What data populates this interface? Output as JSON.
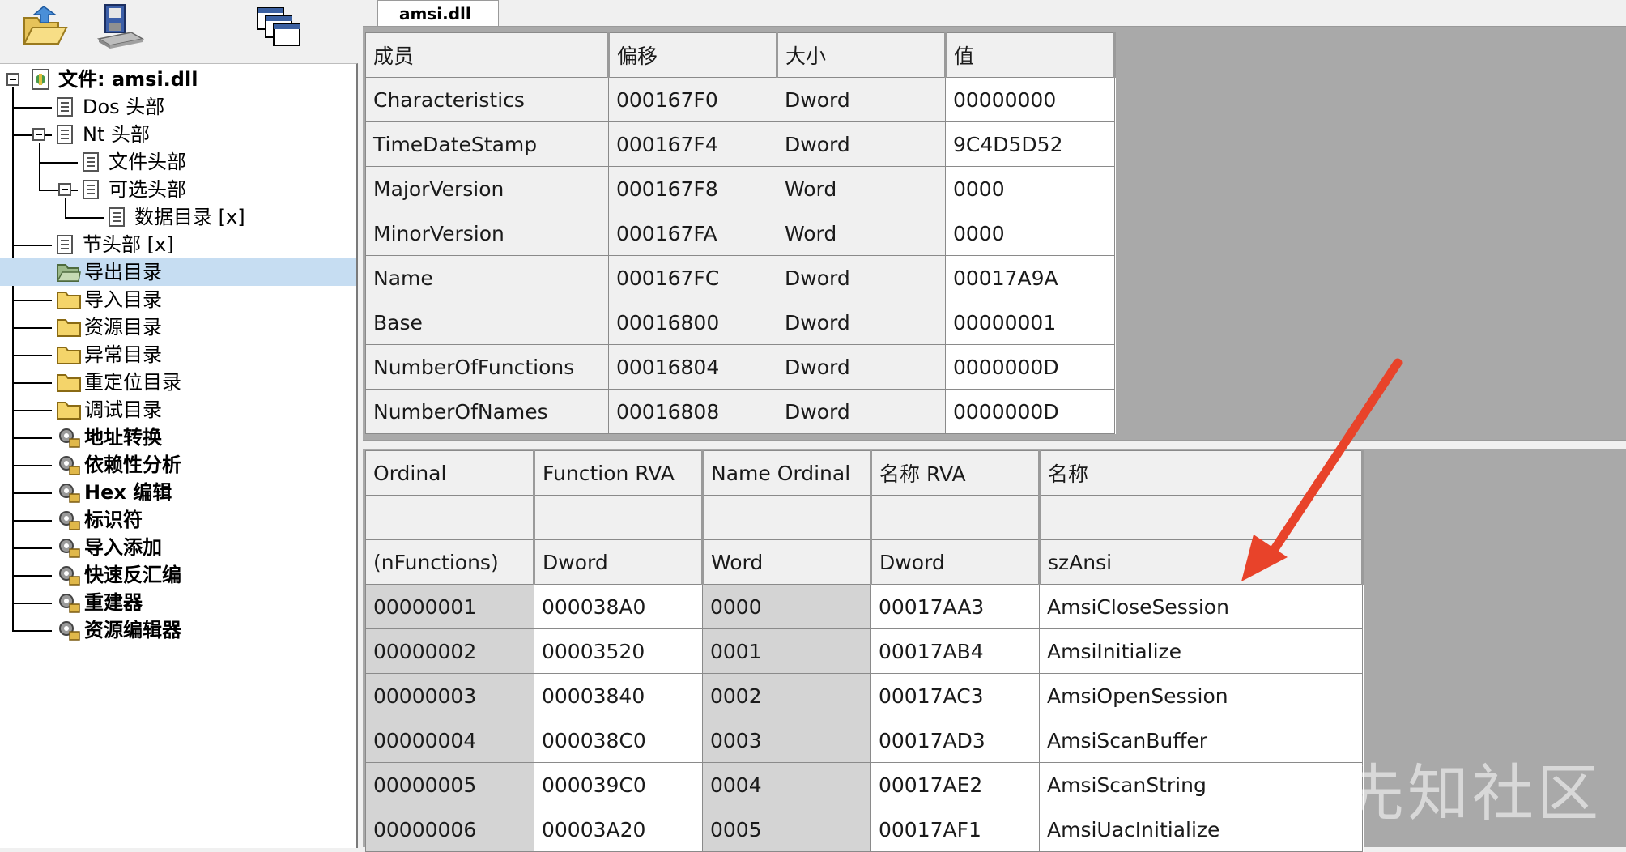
{
  "toolbar": {
    "buttons": [
      {
        "icon": "open-folder-icon"
      },
      {
        "icon": "save-disk-icon"
      },
      {
        "icon": "windows-icon"
      }
    ]
  },
  "tab": {
    "label": "amsi.dll"
  },
  "tree": {
    "root": "文件: amsi.dll",
    "items": [
      {
        "label": "Dos 头部",
        "icon": "page-icon"
      },
      {
        "label": "Nt 头部",
        "icon": "page-icon"
      },
      {
        "label": "文件头部",
        "icon": "page-icon"
      },
      {
        "label": "可选头部",
        "icon": "page-icon"
      },
      {
        "label": "数据目录 [x]",
        "icon": "page-icon"
      },
      {
        "label": "节头部 [x]",
        "icon": "page-icon"
      },
      {
        "label": "导出目录",
        "icon": "folder-open-icon"
      },
      {
        "label": "导入目录",
        "icon": "folder-icon"
      },
      {
        "label": "资源目录",
        "icon": "folder-icon"
      },
      {
        "label": "异常目录",
        "icon": "folder-icon"
      },
      {
        "label": "重定位目录",
        "icon": "folder-icon"
      },
      {
        "label": "调试目录",
        "icon": "folder-icon"
      },
      {
        "label": "地址转换",
        "icon": "tool-icon"
      },
      {
        "label": "依赖性分析",
        "icon": "tool-icon"
      },
      {
        "label": "Hex 编辑",
        "icon": "tool-icon"
      },
      {
        "label": "标识符",
        "icon": "tool-icon"
      },
      {
        "label": "导入添加",
        "icon": "tool-icon"
      },
      {
        "label": "快速反汇编",
        "icon": "tool-icon"
      },
      {
        "label": "重建器",
        "icon": "tool-icon"
      },
      {
        "label": "资源编辑器",
        "icon": "tool-icon"
      }
    ],
    "selected": "导出目录"
  },
  "export_table": {
    "columns": [
      "成员",
      "偏移",
      "大小",
      "值"
    ],
    "rows": [
      [
        "Characteristics",
        "000167F0",
        "Dword",
        "00000000"
      ],
      [
        "TimeDateStamp",
        "000167F4",
        "Dword",
        "9C4D5D52"
      ],
      [
        "MajorVersion",
        "000167F8",
        "Word",
        "0000"
      ],
      [
        "MinorVersion",
        "000167FA",
        "Word",
        "0000"
      ],
      [
        "Name",
        "000167FC",
        "Dword",
        "00017A9A"
      ],
      [
        "Base",
        "00016800",
        "Dword",
        "00000001"
      ],
      [
        "NumberOfFunctions",
        "00016804",
        "Dword",
        "0000000D"
      ],
      [
        "NumberOfNames",
        "00016808",
        "Dword",
        "0000000D"
      ]
    ]
  },
  "functions_table": {
    "columns": [
      "Ordinal",
      "Function RVA",
      "Name Ordinal",
      "名称 RVA",
      "名称"
    ],
    "subheader_blank": [
      "",
      "",
      "",
      "",
      ""
    ],
    "types": [
      "(nFunctions)",
      "Dword",
      "Word",
      "Dword",
      "szAnsi"
    ],
    "rows": [
      [
        "00000001",
        "000038A0",
        "0000",
        "00017AA3",
        "AmsiCloseSession"
      ],
      [
        "00000002",
        "00003520",
        "0001",
        "00017AB4",
        "AmsiInitialize"
      ],
      [
        "00000003",
        "00003840",
        "0002",
        "00017AC3",
        "AmsiOpenSession"
      ],
      [
        "00000004",
        "000038C0",
        "0003",
        "00017AD3",
        "AmsiScanBuffer"
      ],
      [
        "00000005",
        "000039C0",
        "0004",
        "00017AE2",
        "AmsiScanString"
      ],
      [
        "00000006",
        "00003A20",
        "0005",
        "00017AF1",
        "AmsiUacInitialize"
      ]
    ]
  },
  "annotation": {
    "arrow_color": "#e8432a"
  },
  "watermark": {
    "text": "先知社区"
  }
}
